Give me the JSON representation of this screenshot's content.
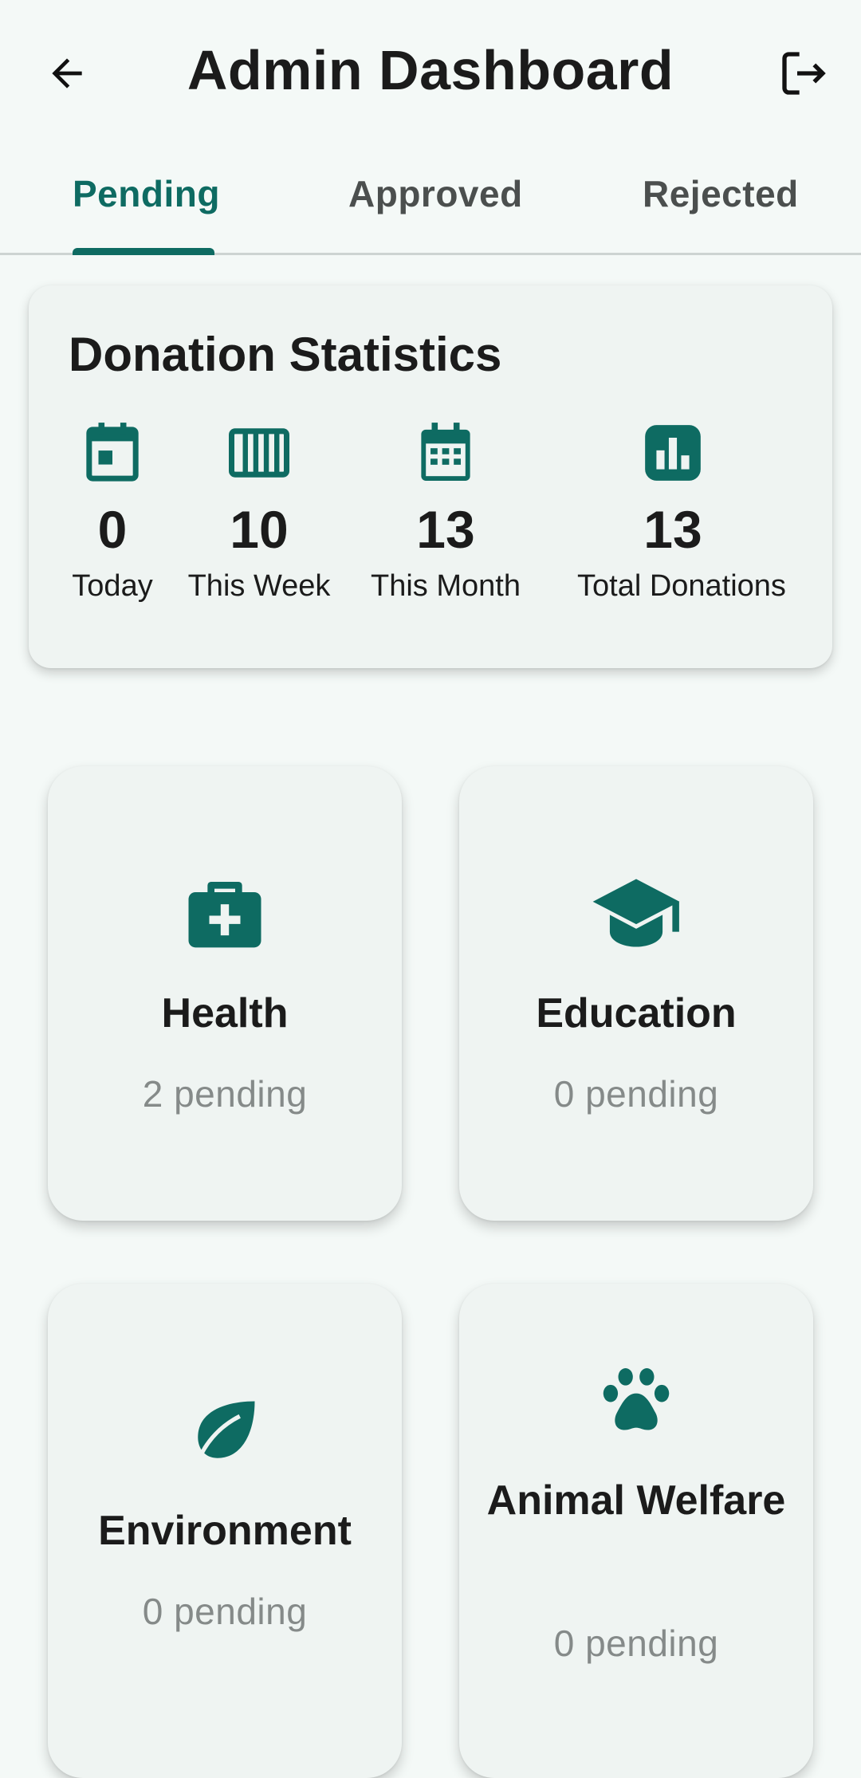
{
  "appbar": {
    "title": "Admin Dashboard"
  },
  "tabs": [
    {
      "label": "Pending",
      "active": true
    },
    {
      "label": "Approved",
      "active": false
    },
    {
      "label": "Rejected",
      "active": false
    }
  ],
  "stats": {
    "title": "Donation Statistics",
    "items": [
      {
        "icon": "calendar-today-icon",
        "value": "0",
        "label": "Today"
      },
      {
        "icon": "calendar-week-icon",
        "value": "10",
        "label": "This Week"
      },
      {
        "icon": "calendar-month-icon",
        "value": "13",
        "label": "This Month"
      },
      {
        "icon": "bar-chart-icon",
        "value": "13",
        "label": "Total Donations"
      }
    ]
  },
  "categories": [
    {
      "icon": "medical-bag-icon",
      "name": "Health",
      "pending": "2 pending"
    },
    {
      "icon": "graduation-cap-icon",
      "name": "Education",
      "pending": "0 pending"
    },
    {
      "icon": "leaf-icon",
      "name": "Environment",
      "pending": "0 pending"
    },
    {
      "icon": "paw-icon",
      "name": "Animal Welfare",
      "pending": "0 pending"
    }
  ],
  "colors": {
    "primary": "#0E6B62",
    "background": "#F4F9F7",
    "card": "#EFF4F2",
    "text": "#1B1B1B",
    "muted": "#858A89"
  }
}
